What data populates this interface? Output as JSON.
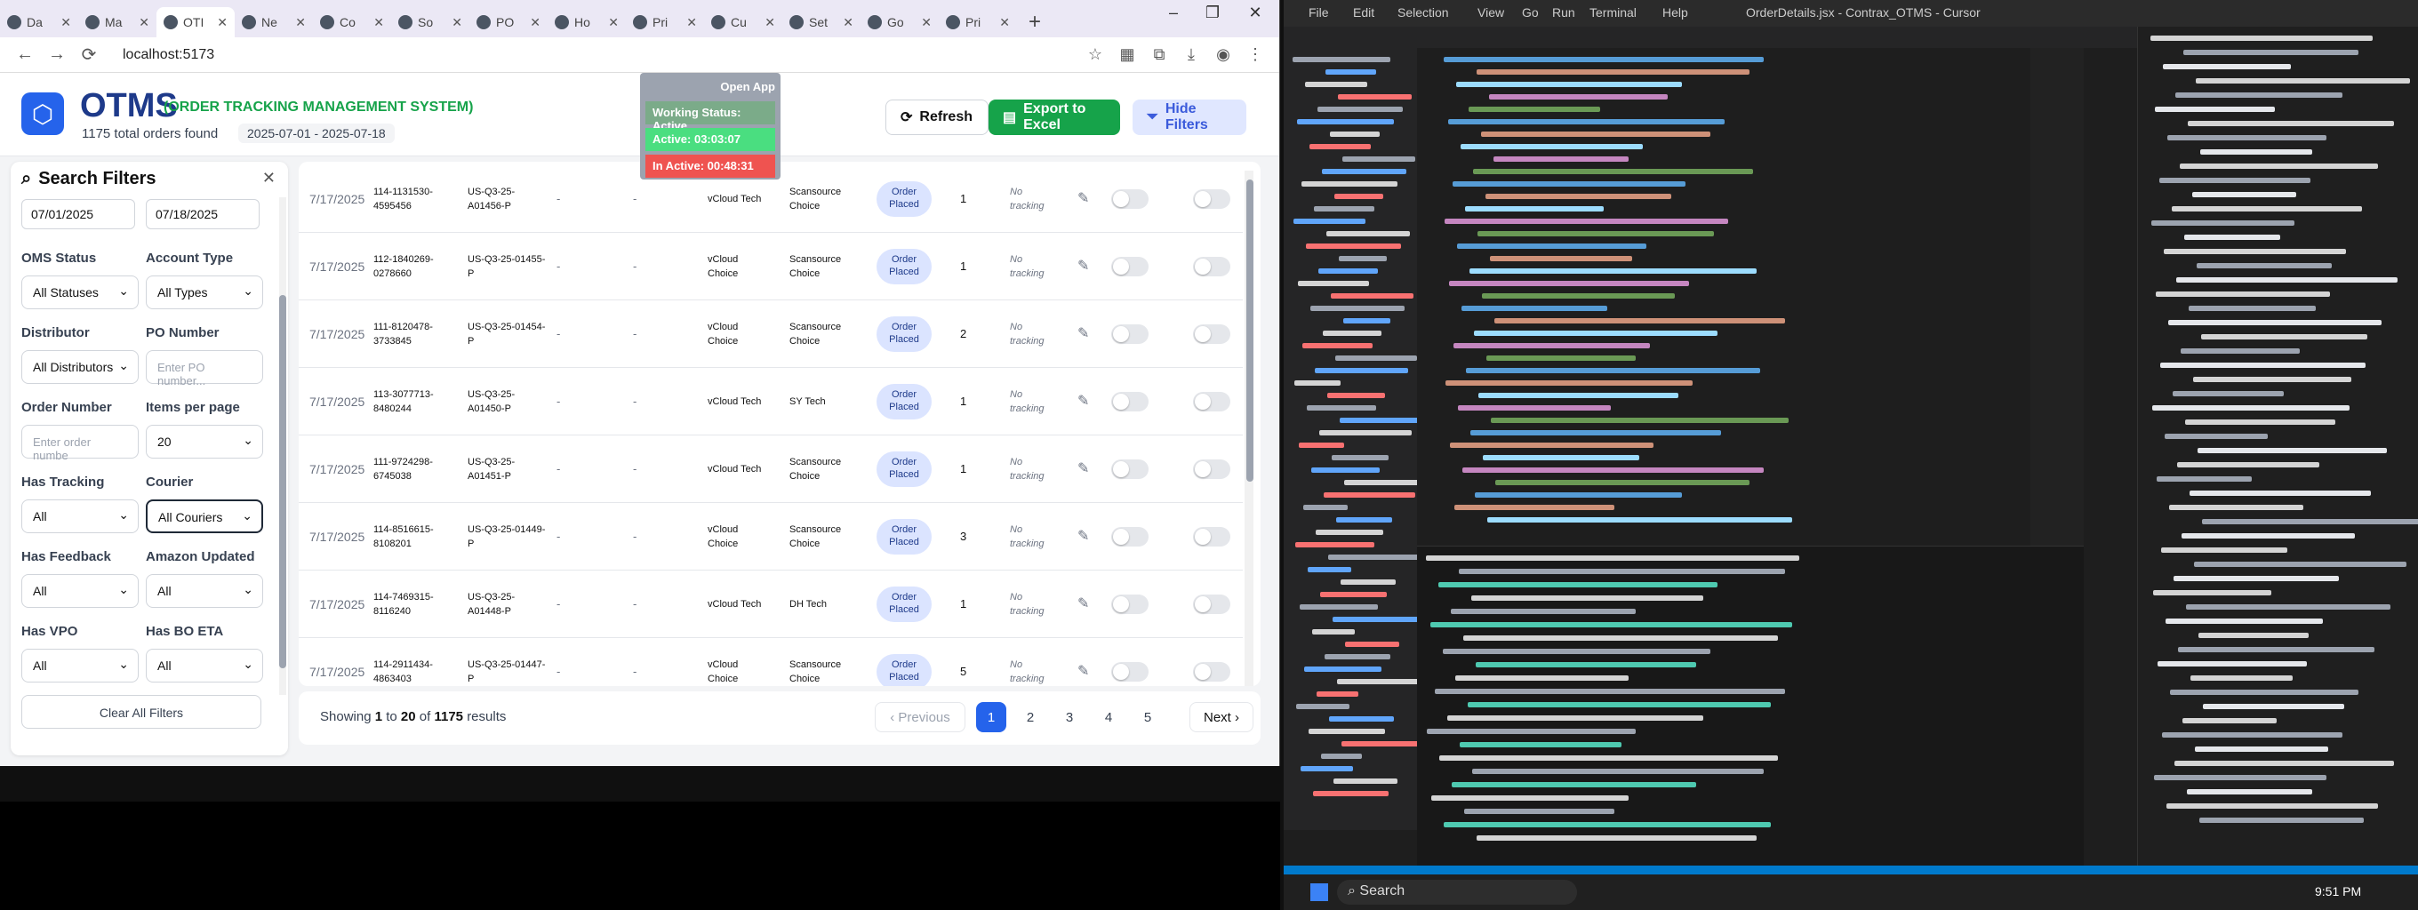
{
  "browser": {
    "tabs": [
      {
        "label": "Da"
      },
      {
        "label": "Ma"
      },
      {
        "label": "OTI"
      },
      {
        "label": "Ne"
      },
      {
        "label": "Co"
      },
      {
        "label": "So"
      },
      {
        "label": "PO"
      },
      {
        "label": "Ho"
      },
      {
        "label": "Pri"
      },
      {
        "label": "Cu"
      },
      {
        "label": "Set"
      },
      {
        "label": "Go"
      },
      {
        "label": "Pri"
      }
    ],
    "url": "localhost:5173"
  },
  "app": {
    "title": "OTMS",
    "subtitle": "(ORDER TRACKING MANAGEMENT SYSTEM)",
    "orders_found": "1175 total orders found",
    "date_range": "2025-07-01 - 2025-07-18",
    "refresh": "Refresh",
    "export": "Export to Excel",
    "hide_filters": "Hide Filters"
  },
  "status_popup": {
    "open_app": "Open App",
    "working": "Working Status: Active",
    "active": "Active: 03:03:07",
    "inactive": "In Active: 00:48:31"
  },
  "filters": {
    "title": "Search Filters",
    "date_from": "07/01/2025",
    "date_to": "07/18/2025",
    "oms_status_label": "OMS Status",
    "oms_status_value": "All Statuses",
    "account_type_label": "Account Type",
    "account_type_value": "All Types",
    "distributor_label": "Distributor",
    "distributor_value": "All Distributors",
    "po_label": "PO Number",
    "po_placeholder": "Enter PO number...",
    "order_label": "Order Number",
    "order_placeholder": "Enter order numbe",
    "items_label": "Items per page",
    "items_value": "20",
    "tracking_label": "Has Tracking",
    "tracking_value": "All",
    "courier_label": "Courier",
    "courier_value": "All Couriers",
    "feedback_label": "Has Feedback",
    "feedback_value": "All",
    "amazon_label": "Amazon Updated",
    "amazon_value": "All",
    "vpo_label": "Has VPO",
    "vpo_value": "All",
    "bo_label": "Has BO ETA",
    "bo_value": "All",
    "clear_all": "Clear All Filters"
  },
  "orders": [
    {
      "date": "7/17/2025",
      "order": "114-1131530-4595456",
      "po": "US-Q3-25-A01456-P",
      "d1": "-",
      "d2": "-",
      "account": "vCloud Tech",
      "distributor": "Scansource Choice",
      "status": "Order Placed",
      "qty": "1",
      "tracking": "No tracking"
    },
    {
      "date": "7/17/2025",
      "order": "112-1840269-0278660",
      "po": "US-Q3-25-01455-P",
      "d1": "-",
      "d2": "-",
      "account": "vCloud Choice",
      "distributor": "Scansource Choice",
      "status": "Order Placed",
      "qty": "1",
      "tracking": "No tracking"
    },
    {
      "date": "7/17/2025",
      "order": "111-8120478-3733845",
      "po": "US-Q3-25-01454-P",
      "d1": "-",
      "d2": "-",
      "account": "vCloud Choice",
      "distributor": "Scansource Choice",
      "status": "Order Placed",
      "qty": "2",
      "tracking": "No tracking"
    },
    {
      "date": "7/17/2025",
      "order": "113-3077713-8480244",
      "po": "US-Q3-25-A01450-P",
      "d1": "-",
      "d2": "-",
      "account": "vCloud Tech",
      "distributor": "SY Tech",
      "status": "Order Placed",
      "qty": "1",
      "tracking": "No tracking"
    },
    {
      "date": "7/17/2025",
      "order": "111-9724298-6745038",
      "po": "US-Q3-25-A01451-P",
      "d1": "-",
      "d2": "-",
      "account": "vCloud Tech",
      "distributor": "Scansource Choice",
      "status": "Order Placed",
      "qty": "1",
      "tracking": "No tracking"
    },
    {
      "date": "7/17/2025",
      "order": "114-8516615-8108201",
      "po": "US-Q3-25-01449-P",
      "d1": "-",
      "d2": "-",
      "account": "vCloud Choice",
      "distributor": "Scansource Choice",
      "status": "Order Placed",
      "qty": "3",
      "tracking": "No tracking"
    },
    {
      "date": "7/17/2025",
      "order": "114-7469315-8116240",
      "po": "US-Q3-25-A01448-P",
      "d1": "-",
      "d2": "-",
      "account": "vCloud Tech",
      "distributor": "DH Tech",
      "status": "Order Placed",
      "qty": "1",
      "tracking": "No tracking"
    },
    {
      "date": "7/17/2025",
      "order": "114-2911434-4863403",
      "po": "US-Q3-25-01447-P",
      "d1": "-",
      "d2": "-",
      "account": "vCloud Choice",
      "distributor": "Scansource Choice",
      "status": "Order Placed",
      "qty": "5",
      "tracking": "No tracking"
    }
  ],
  "pagination": {
    "showing_prefix": "Showing",
    "from": "1",
    "to_word": "to",
    "to": "20",
    "of_word": "of",
    "total": "1175",
    "suffix": "results",
    "prev": "Previous",
    "pages": [
      "1",
      "2",
      "3",
      "4",
      "5"
    ],
    "next": "Next"
  },
  "taskbar": {
    "search": "Search",
    "clock": "9:51 PM"
  },
  "editor": {
    "menus": [
      "File",
      "Edit",
      "Selection",
      "View",
      "Go",
      "Run",
      "Terminal",
      "Help"
    ],
    "title": "OrderDetails.jsx - Contrax_OTMS - Cursor"
  }
}
